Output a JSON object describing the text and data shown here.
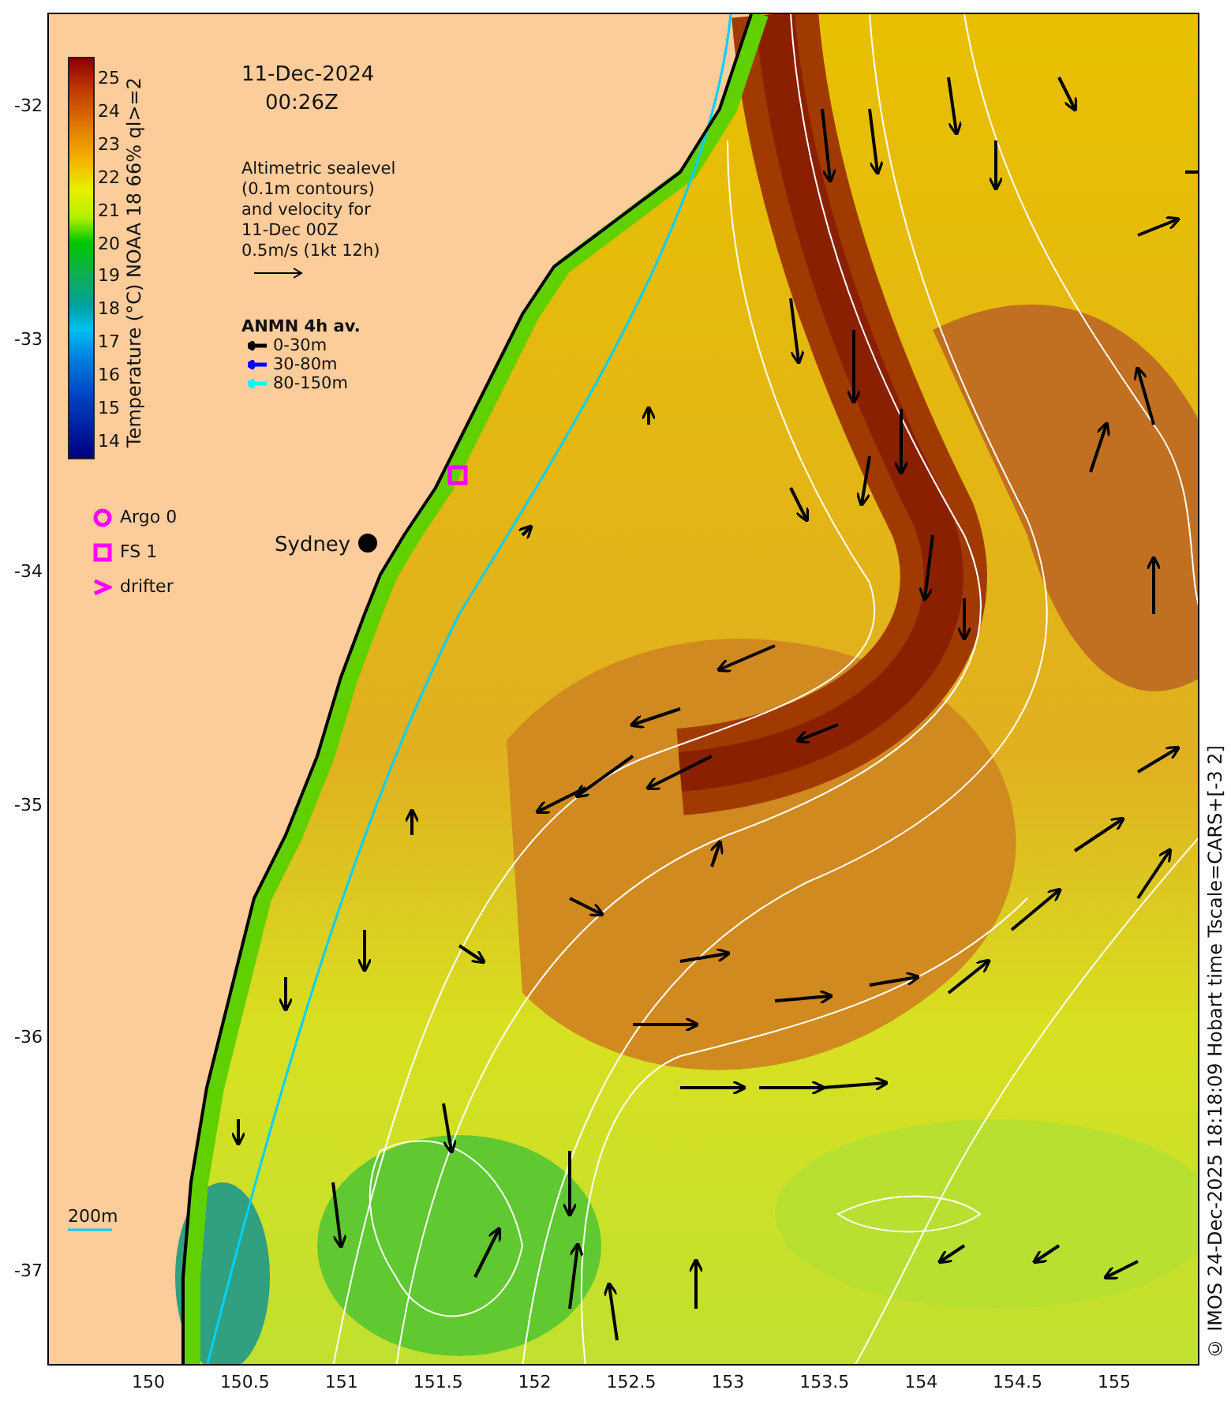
{
  "plot": {
    "date": "11-Dec-2024",
    "time": "00:26Z",
    "altimetry_legend": {
      "lines": [
        "Altimetric sealevel",
        "(0.1m contours)",
        "and velocity for",
        "11-Dec 00Z",
        "0.5m/s (1kt 12h)"
      ]
    },
    "anmn_legend": {
      "title": "ANMN 4h av.",
      "items": [
        {
          "label": "0-30m",
          "color": "#000000"
        },
        {
          "label": "30-80m",
          "color": "#0000ff"
        },
        {
          "label": "80-150m",
          "color": "#00ffff"
        }
      ]
    },
    "markers_legend": [
      {
        "kind": "circle",
        "label": "Argo 0"
      },
      {
        "kind": "square",
        "label": "FS 1"
      },
      {
        "kind": "chevron",
        "label": "drifter"
      }
    ],
    "place_label": "Sydney",
    "depth_label": "200m",
    "colorbar": {
      "label": "Temperature (°C) NOAA 18 66% ql>=2",
      "ticks": [
        "25",
        "24",
        "23",
        "22",
        "21",
        "20",
        "19",
        "18",
        "17",
        "16",
        "15",
        "14"
      ]
    },
    "y_axis": {
      "ticks": [
        "-32",
        "-33",
        "-34",
        "-35",
        "-36",
        "-37"
      ]
    },
    "x_axis": {
      "ticks": [
        "150",
        "150.5",
        "151",
        "151.5",
        "152",
        "152.5",
        "153",
        "153.5",
        "154",
        "154.5",
        "155"
      ]
    },
    "credit": "© IMOS 24-Dec-2025 18:18:09 Hobart time Tscale=CARS+[-3 2]"
  }
}
